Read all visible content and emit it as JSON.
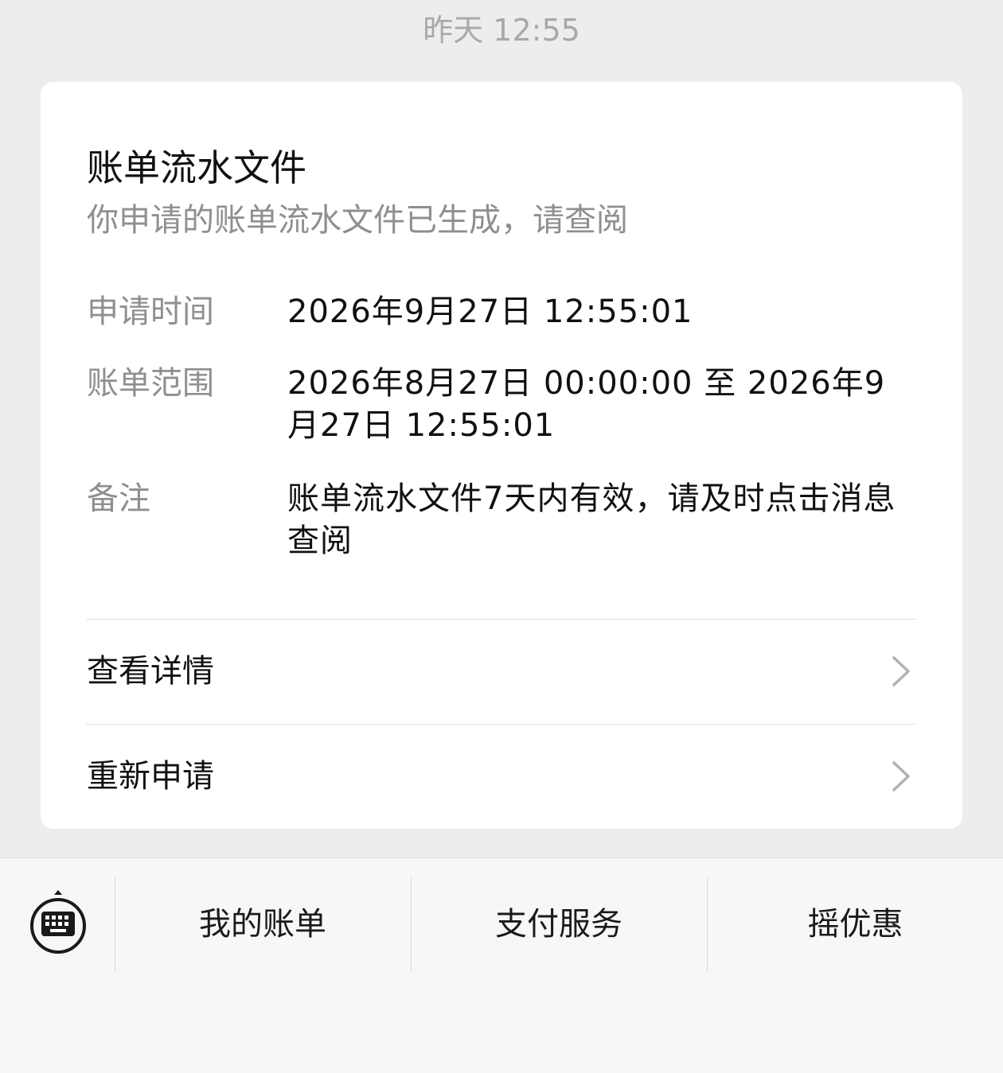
{
  "timestamp": "昨天 12:55",
  "card": {
    "title": "账单流水文件",
    "subtitle": "你申请的账单流水文件已生成，请查阅",
    "rows": [
      {
        "label": "申请时间",
        "value": "2026年9月27日 12:55:01"
      },
      {
        "label": "账单范围",
        "value": "2026年8月27日 00:00:00 至 2026年9月27日 12:55:01"
      },
      {
        "label": "备注",
        "value": "账单流水文件7天内有效，请及时点击消息查阅"
      }
    ],
    "actions": [
      {
        "label": "查看详情",
        "icon": "chevron-right-icon"
      },
      {
        "label": "重新申请",
        "icon": "chevron-right-icon"
      }
    ]
  },
  "bottom_menu": {
    "keyboard_icon": "keyboard-icon",
    "items": [
      {
        "label": "我的账单"
      },
      {
        "label": "支付服务"
      },
      {
        "label": "摇优惠"
      }
    ]
  },
  "colors": {
    "background": "#ededed",
    "card": "#ffffff",
    "primary_text": "#111111",
    "secondary_text": "#8f8f8f",
    "timestamp_text": "#a8a8a8",
    "chevron": "#b2b2b2"
  }
}
